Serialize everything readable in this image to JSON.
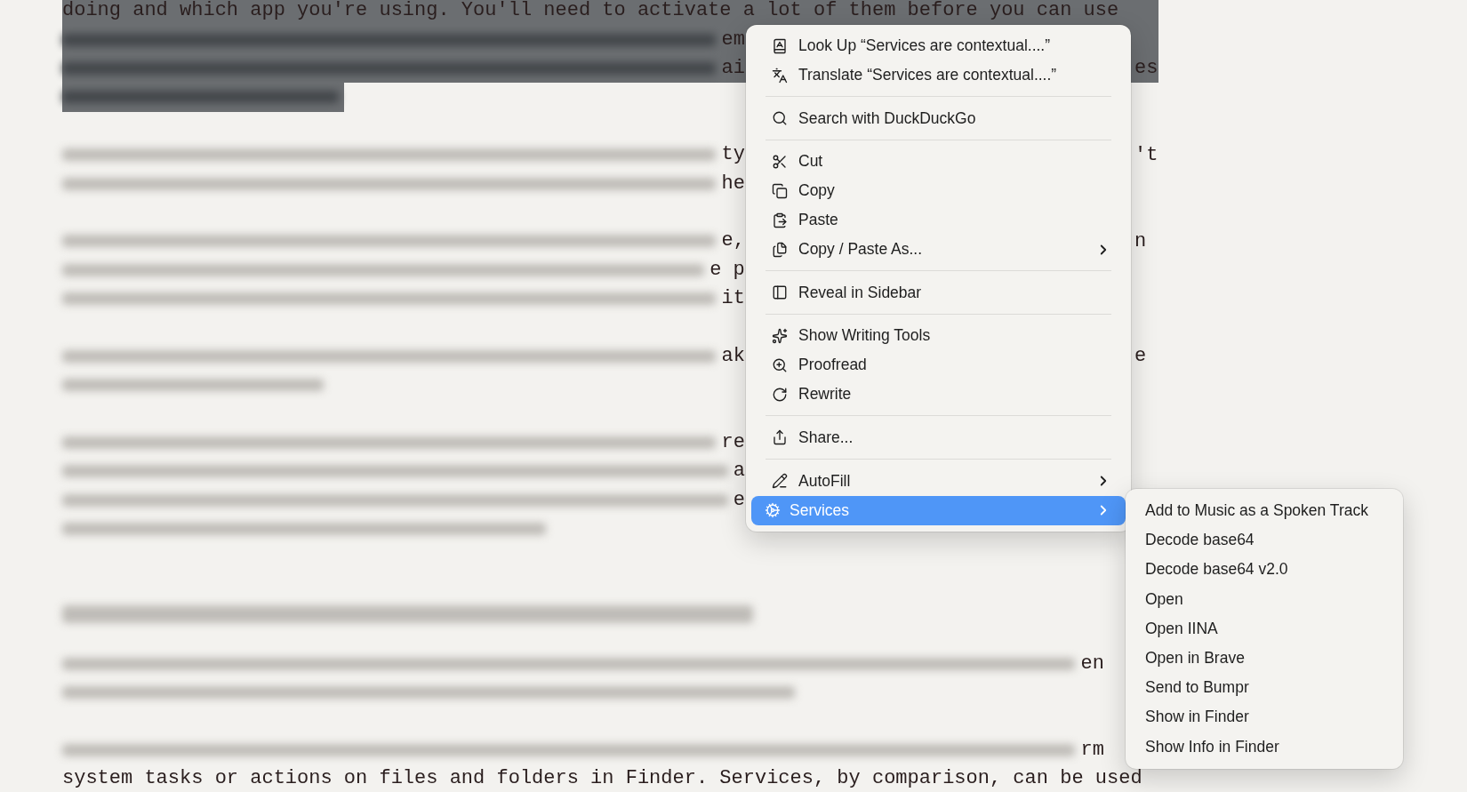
{
  "document": {
    "paragraphs": [
      {
        "kind": "body",
        "lines": [
          {
            "kind": "text",
            "selected": true,
            "text": "doing and which app you're using. You'll need to activate a lot of them before you can use"
          },
          {
            "kind": "blurred",
            "selected": true,
            "edge_text": "em"
          },
          {
            "kind": "blurred",
            "selected": true,
            "edge_text": "ai",
            "far_text": "es"
          },
          {
            "kind": "blurred",
            "selected": true
          }
        ]
      },
      {
        "kind": "body",
        "lines": [
          {
            "kind": "blurred",
            "selected": false,
            "edge_text": "ty",
            "far_text": "'t"
          },
          {
            "kind": "blurred",
            "selected": false,
            "edge_text": "he"
          }
        ]
      },
      {
        "kind": "body",
        "lines": [
          {
            "kind": "blurred",
            "selected": false,
            "edge_text": "e,",
            "far_text": "n"
          },
          {
            "kind": "blurred",
            "selected": false,
            "edge_text": "e p"
          },
          {
            "kind": "blurred",
            "selected": false,
            "edge_text": "it"
          }
        ]
      },
      {
        "kind": "body",
        "lines": [
          {
            "kind": "blurred",
            "selected": false,
            "edge_text": "ak",
            "far_text": "e"
          },
          {
            "kind": "blurred",
            "selected": false
          }
        ]
      },
      {
        "kind": "body",
        "lines": [
          {
            "kind": "blurred",
            "selected": false,
            "edge_text": "re"
          },
          {
            "kind": "blurred",
            "selected": false,
            "edge_text": "a"
          },
          {
            "kind": "blurred",
            "selected": false,
            "edge_text": "e"
          },
          {
            "kind": "blurred",
            "selected": false
          }
        ]
      },
      {
        "kind": "heading",
        "lines": [
          {
            "kind": "blurred",
            "selected": false
          }
        ]
      },
      {
        "kind": "body",
        "lines": [
          {
            "kind": "blurred",
            "selected": false,
            "edge_text": "en"
          },
          {
            "kind": "blurred",
            "selected": false
          }
        ]
      },
      {
        "kind": "body",
        "lines": [
          {
            "kind": "blurred",
            "selected": false,
            "edge_text": "rm"
          },
          {
            "kind": "text",
            "selected": false,
            "text": "system tasks or actions on files and folders in Finder. Services, by comparison, can be used"
          }
        ]
      }
    ]
  },
  "context_menu": {
    "groups": [
      [
        {
          "label": "Look Up “Services are contextual....”",
          "has_submenu": false,
          "selected": false
        },
        {
          "label": "Translate “Services are contextual....”",
          "has_submenu": false,
          "selected": false
        }
      ],
      [
        {
          "label": "Search with DuckDuckGo",
          "has_submenu": false,
          "selected": false
        }
      ],
      [
        {
          "label": "Cut",
          "has_submenu": false,
          "selected": false
        },
        {
          "label": "Copy",
          "has_submenu": false,
          "selected": false
        },
        {
          "label": "Paste",
          "has_submenu": false,
          "selected": false
        },
        {
          "label": "Copy / Paste As...",
          "has_submenu": true,
          "selected": false
        }
      ],
      [
        {
          "label": "Reveal in Sidebar",
          "has_submenu": false,
          "selected": false
        }
      ],
      [
        {
          "label": "Show Writing Tools",
          "has_submenu": false,
          "selected": false
        },
        {
          "label": "Proofread",
          "has_submenu": false,
          "selected": false
        },
        {
          "label": "Rewrite",
          "has_submenu": false,
          "selected": false
        }
      ],
      [
        {
          "label": "Share...",
          "has_submenu": false,
          "selected": false
        }
      ],
      [
        {
          "label": "AutoFill",
          "has_submenu": true,
          "selected": false
        },
        {
          "label": "Services",
          "has_submenu": true,
          "selected": true
        }
      ]
    ]
  },
  "services_submenu": {
    "items": [
      {
        "label": "Add to Music as a Spoken Track"
      },
      {
        "label": "Decode base64"
      },
      {
        "label": "Decode base64 v2.0"
      },
      {
        "label": "Open"
      },
      {
        "label": "Open IINA"
      },
      {
        "label": "Open in Brave"
      },
      {
        "label": "Send to Bumpr"
      },
      {
        "label": "Show in Finder"
      },
      {
        "label": "Show Info in Finder"
      }
    ]
  }
}
